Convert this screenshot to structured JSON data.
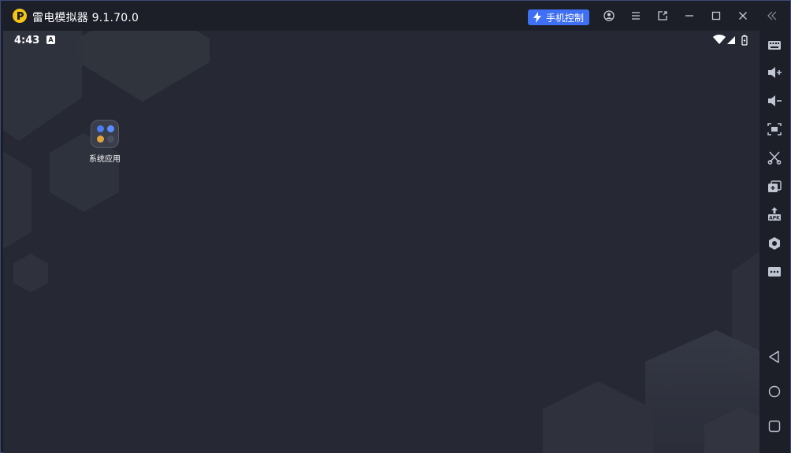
{
  "window": {
    "title": "雷电模拟器 9.1.70.0",
    "phone_control_label": "手机控制",
    "accent": "#3f6ff2",
    "logo_color": "#f5c518"
  },
  "titlebar_icons": [
    "account-icon",
    "menu-icon",
    "popout-icon",
    "minimize-icon",
    "maximize-icon",
    "close-icon",
    "collapse-sidebar-icon"
  ],
  "statusbar": {
    "time": "4:43",
    "badge": "A"
  },
  "desktop": {
    "folder_label": "系统应用"
  },
  "sidebar": {
    "top_items": [
      "keyboard-mapping-icon",
      "volume-up-icon",
      "volume-down-icon",
      "screenshot-icon",
      "scissors-icon",
      "multi-instance-icon",
      "install-apk-icon",
      "settings-hex-icon",
      "more-icon"
    ],
    "apk_label": "APK",
    "nav_items": [
      "back-icon",
      "home-icon",
      "recents-icon"
    ]
  }
}
